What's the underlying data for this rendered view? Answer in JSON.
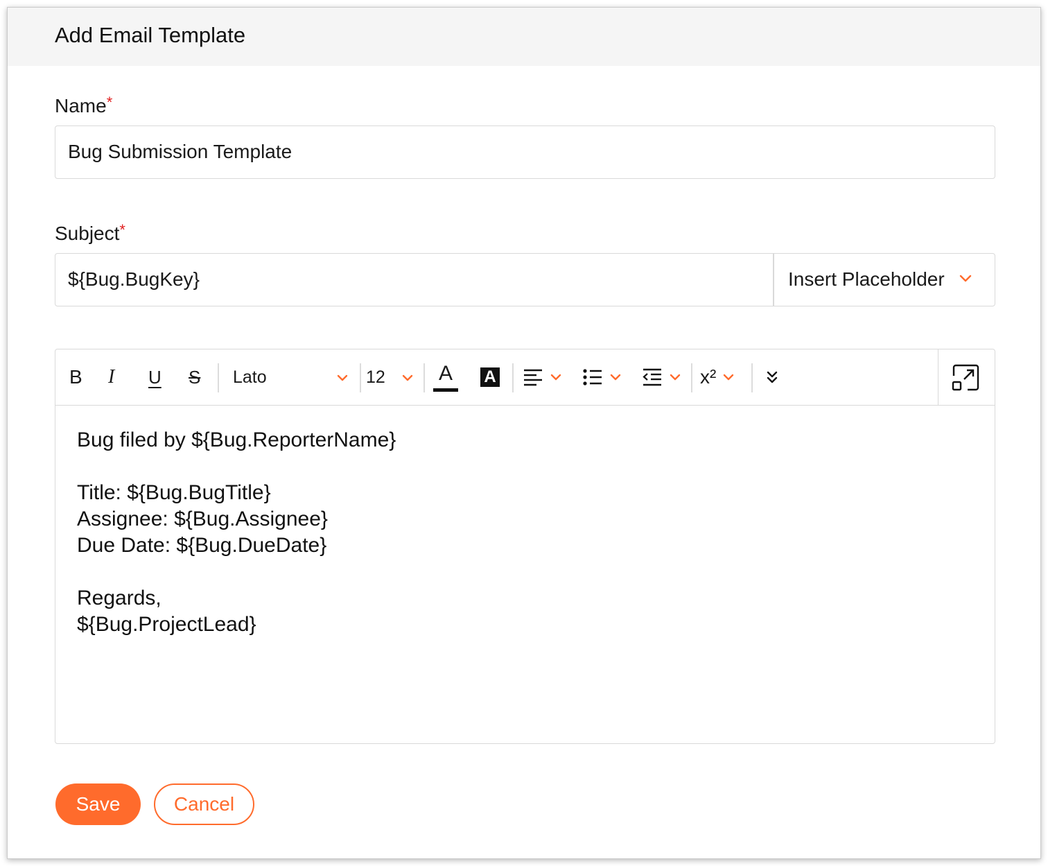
{
  "dialog": {
    "title": "Add Email Template"
  },
  "name_field": {
    "label": "Name",
    "required_mark": "*",
    "value": "Bug Submission Template"
  },
  "subject_field": {
    "label": "Subject",
    "required_mark": "*",
    "value": "${Bug.BugKey}",
    "insert_placeholder_label": "Insert Placeholder"
  },
  "toolbar": {
    "bold": "B",
    "italic": "I",
    "underline": "U",
    "strikethrough": "S",
    "font_family": "Lato",
    "font_size": "12",
    "font_color_glyph": "A",
    "highlight_glyph": "A",
    "superscript_glyph": "x²",
    "icons": [
      "bold-icon",
      "italic-icon",
      "underline-icon",
      "strikethrough-icon",
      "font-color-icon",
      "highlight-icon",
      "align-left-icon",
      "bullet-list-icon",
      "outdent-icon",
      "superscript-icon",
      "more-icon",
      "expand-icon"
    ]
  },
  "editor": {
    "lines": [
      "Bug filed by ${Bug.ReporterName}",
      "",
      "Title: ${Bug.BugTitle}",
      "Assignee: ${Bug.Assignee}",
      "Due Date: ${Bug.DueDate}",
      "",
      "Regards,",
      "${Bug.ProjectLead}"
    ]
  },
  "actions": {
    "save_label": "Save",
    "cancel_label": "Cancel"
  },
  "colors": {
    "accent": "#ff6b2c",
    "required": "#e02020"
  }
}
